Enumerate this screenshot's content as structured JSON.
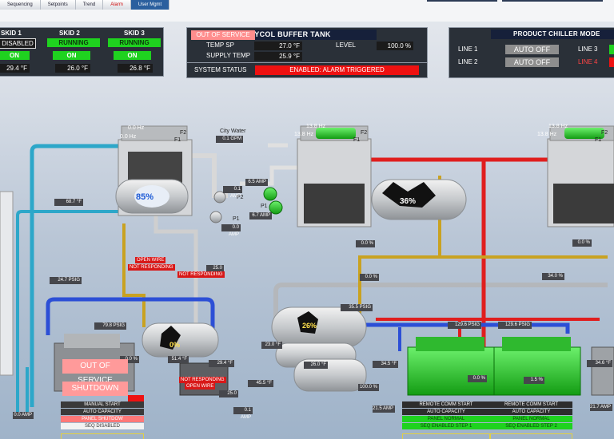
{
  "nav": {
    "items": [
      "Sequencing",
      "Setpoints",
      "Trend",
      "Alarm",
      "User Mgmt"
    ]
  },
  "skids": [
    {
      "name": "SKID 1",
      "state": "DISABLED",
      "on": "ON",
      "temp": "29.4 °F"
    },
    {
      "name": "SKID 2",
      "state": "RUNNING",
      "on": "ON",
      "temp": "26.0 °F"
    },
    {
      "name": "SKID 3",
      "state": "RUNNING",
      "on": "ON",
      "temp": "26.8 °F"
    }
  ],
  "glycol": {
    "title": "GLYCOL BUFFER TANK",
    "oos": "OUT OF SERVICE",
    "temp_sp_label": "TEMP SP",
    "temp_sp": "27.0 °F",
    "level_label": "LEVEL",
    "level": "100.0 %",
    "supply_label": "SUPPLY TEMP",
    "supply": "25.9 °F",
    "status_label": "SYSTEM STATUS",
    "status": "ENABLED: ALARM TRIGGERED"
  },
  "chiller_mode": {
    "title": "PRODUCT CHILLER MODE",
    "line1_label": "LINE 1",
    "line1": "AUTO OFF",
    "line2_label": "LINE 2",
    "line2": "AUTO OFF",
    "line3_label": "LINE 3",
    "line4_label": "LINE 4"
  },
  "process": {
    "hx_left": {
      "hz1": "0.0 Hz",
      "hz2": "0.0 Hz",
      "f1": "F1",
      "f2": "F2",
      "level": "85%"
    },
    "city_water": {
      "label": "City Water",
      "flow": "0.1 GPM"
    },
    "hx_mid": {
      "hz1": "13.8 Hz",
      "hz2": "13.8 Hz",
      "f1": "F1",
      "f2": "F2"
    },
    "hx_right": {
      "hz1": "13.8 Hz",
      "hz2": "13.8 Hz",
      "f1": "F1",
      "f2": "F2"
    },
    "tank_mid_level": "36%",
    "p1": "P1",
    "p2": "P2",
    "p1b": "P1",
    "amps": {
      "a1": "0.1 AMP",
      "a2": "0.0 AMP",
      "a3": "6.5 AMP",
      "a4": "6.7 AMP",
      "a5": "0.1 AMP",
      "a6": "0.0 AMP",
      "a7": "21.5 AMP",
      "a8": "21.7 AMP"
    },
    "readouts": {
      "t687": "68.7 °F",
      "psig247": "24.7 PSIG",
      "psig798": "79.8 PSIG",
      "n250a": "25.0",
      "n250b": "25.0",
      "t294": "29.4 °F",
      "t455": "45.5 °F",
      "p00a": "0.0 %",
      "p00b": "0.0 %",
      "p00c": "0.0 %",
      "p00d": "0.0 %",
      "p00e": "0.0 %",
      "p340": "34.0 %",
      "psig355": "35.5 PSIG",
      "t230": "23.0 °F",
      "t260": "26.0 °F",
      "psig345a": "34.5 °F",
      "psig1296a": "129.6 PSIG",
      "psig1296b": "129.6 PSIG",
      "t346": "34.6 °F",
      "p15": "1.5 %",
      "p100": "100.0 %",
      "n514": "51.4 °F"
    },
    "alarms": {
      "open_wire": "OPEN WIRE",
      "not_resp1": "NOT RESPONDING",
      "not_resp2": "NOT RESPONDING",
      "not_resp3": "NOT RESPONDING",
      "open_wire2": "OPEN WIRE"
    },
    "tank_small_level": "0%",
    "sep_level": "26%"
  },
  "compressor_left": {
    "oos": "OUT OF SERVICE",
    "shutdown": "SHUTDOWN",
    "manual_start": "MANUAL START",
    "auto_capacity": "AUTO CAPACITY",
    "panel_state": "PANEL SHUTDOW",
    "seq": "SEQ DISABLED"
  },
  "compressor_mid": {
    "start": "REMOTE COMM START",
    "capacity": "AUTO CAPACITY",
    "panel": "PANEL NORMAL",
    "seq": "SEQ ENABLED STEP 1"
  },
  "compressor_right": {
    "start": "REMOTE COMM START",
    "capacity": "AUTO CAPACITY",
    "panel": "PANEL NORMAL",
    "seq": "SEQ ENABLED STEP 2"
  }
}
